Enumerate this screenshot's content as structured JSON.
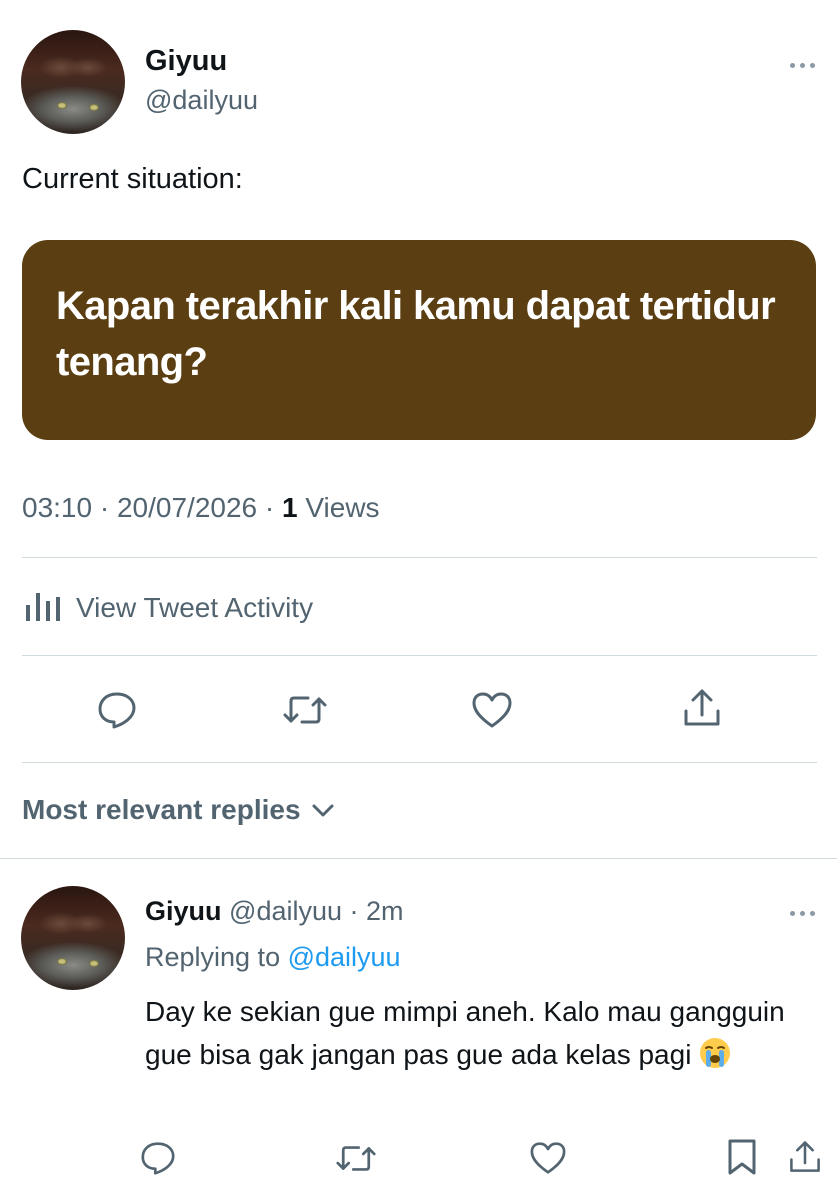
{
  "tweet": {
    "author_name": "Giyuu",
    "author_handle": "@dailyuu",
    "text": "Current situation:",
    "media_text": "Kapan terakhir kali kamu dapat tertidur tenang?",
    "time": "03:10",
    "sep1": " · ",
    "date": "20/07/2026",
    "sep2": " · ",
    "views_count": "1",
    "views_label": " Views",
    "media_color": "#5b3e12"
  },
  "activity": {
    "label": "View Tweet Activity",
    "icon": "bar-chart-icon"
  },
  "actions": {
    "icons": [
      "reply-icon",
      "retweet-icon",
      "like-icon",
      "share-icon"
    ]
  },
  "replies": {
    "heading": "Most relevant replies",
    "chevron_icon": "chevron-down-icon"
  },
  "reply": {
    "author_name": "Giyuu",
    "author_handle": "@dailyuu",
    "sep": " · ",
    "time": "2m",
    "replying_prefix": "Replying to ",
    "replying_to": "@dailyuu",
    "text": "Day ke sekian gue mimpi aneh. Kalo mau gangguin gue bisa gak jangan pas gue ada kelas pagi",
    "emoji": "loudly-crying-face-emoji",
    "icons": [
      "reply-icon",
      "retweet-icon",
      "like-icon",
      "bookmark-icon",
      "share-icon"
    ]
  },
  "colors": {
    "link": "#1d9bf0",
    "secondary_text": "#536471",
    "divider": "#cfd9de"
  }
}
